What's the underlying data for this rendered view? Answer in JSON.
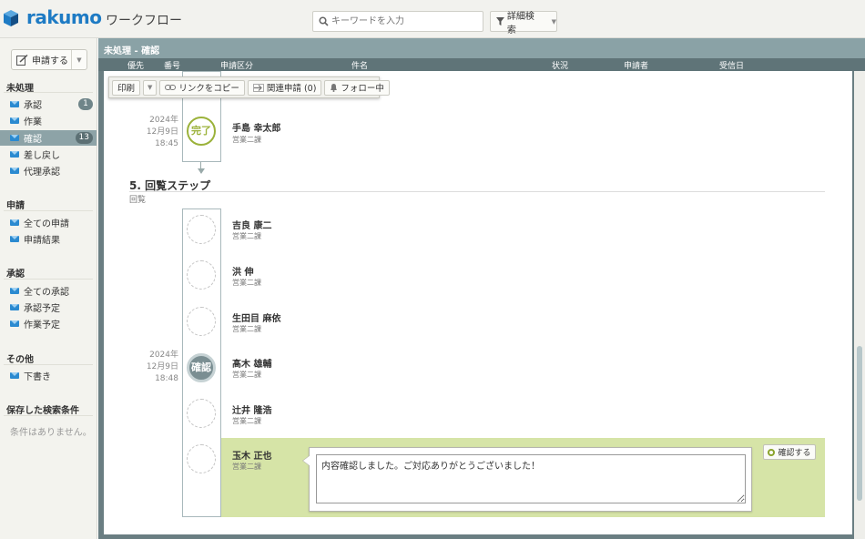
{
  "header": {
    "logo_text": "rakumo",
    "app_title": "ワークフロー",
    "search_placeholder": "キーワードを入力",
    "advanced_search": "詳細検索"
  },
  "sidebar": {
    "new_request_label": "申請する",
    "sections": {
      "unprocessed": "未処理",
      "requests": "申請",
      "approvals": "承認",
      "other": "その他",
      "saved_search": "保存した検索条件"
    },
    "items": {
      "approve": {
        "label": "承認",
        "badge": "1"
      },
      "work": {
        "label": "作業"
      },
      "confirm": {
        "label": "確認",
        "badge": "13"
      },
      "returned": {
        "label": "差し戻し"
      },
      "proxy": {
        "label": "代理承認"
      },
      "all_requests": {
        "label": "全ての申請"
      },
      "request_results": {
        "label": "申請結果"
      },
      "all_approvals": {
        "label": "全ての承認"
      },
      "scheduled_approval": {
        "label": "承認予定"
      },
      "scheduled_work": {
        "label": "作業予定"
      },
      "drafts": {
        "label": "下書き"
      }
    },
    "saved_search_empty": "条件はありません。"
  },
  "main": {
    "title": "未処理 - 確認",
    "columns": [
      "優先",
      "番号",
      "申請区分",
      "件名",
      "状況",
      "申請者",
      "受信日"
    ]
  },
  "toolbar": {
    "print": "印刷",
    "copy_link": "リンクをコピー",
    "related": "関連申請 (0)",
    "follow": "フォロー中"
  },
  "timeline": {
    "prev_step": {
      "date_year": "2024年",
      "date_day": "12月9日",
      "date_time": "18:45",
      "status": "完了",
      "name": "手島 幸太郎",
      "dept": "営業二課"
    },
    "step5": {
      "title": "5. 回覧ステップ",
      "subtitle": "回覧",
      "members": [
        {
          "name": "吉良 康二",
          "dept": "営業二課"
        },
        {
          "name": "洪 伸",
          "dept": "営業二課"
        },
        {
          "name": "生田目 麻依",
          "dept": "営業二課"
        },
        {
          "name": "髙木 雄輔",
          "dept": "営業二課",
          "status": "確認",
          "date_year": "2024年",
          "date_day": "12月9日",
          "date_time": "18:48"
        },
        {
          "name": "辻井 隆浩",
          "dept": "営業二課"
        },
        {
          "name": "玉木 正也",
          "dept": "営業二課"
        }
      ]
    },
    "comment": "内容確認しました。ご対応ありがとうございました！",
    "confirm_button": "確認する"
  },
  "colors": {
    "brand": "#1e7bc4",
    "header": "#8aa2a6",
    "highlight": "#d6e4a7",
    "done": "#9bb23a"
  }
}
